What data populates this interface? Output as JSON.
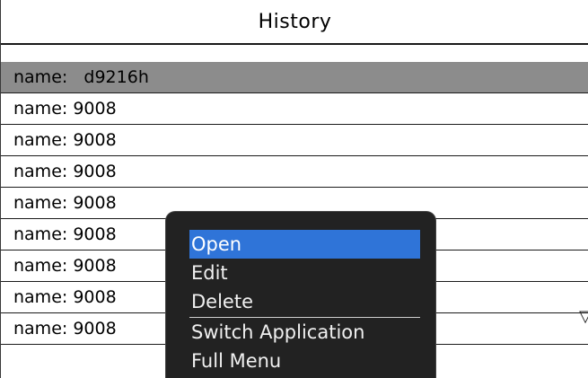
{
  "header": {
    "title": "History"
  },
  "list": {
    "items": [
      {
        "label": "name:   d9216h",
        "selected": true
      },
      {
        "label": "name: 9008"
      },
      {
        "label": "name: 9008"
      },
      {
        "label": "name: 9008"
      },
      {
        "label": "name: 9008"
      },
      {
        "label": "name: 9008"
      },
      {
        "label": "name: 9008"
      },
      {
        "label": "name: 9008"
      },
      {
        "label": "name: 9008"
      }
    ],
    "scroll_indicator": "▽"
  },
  "context_menu": {
    "items": [
      {
        "label": "Open",
        "active": true
      },
      {
        "label": "Edit"
      },
      {
        "label": "Delete"
      }
    ],
    "items_after_separator": [
      {
        "label": "Switch Application"
      },
      {
        "label": "Full Menu"
      }
    ]
  },
  "colors": {
    "selection_row": "#8c8c8c",
    "menu_background": "#222222",
    "menu_highlight": "#2f74d8"
  }
}
